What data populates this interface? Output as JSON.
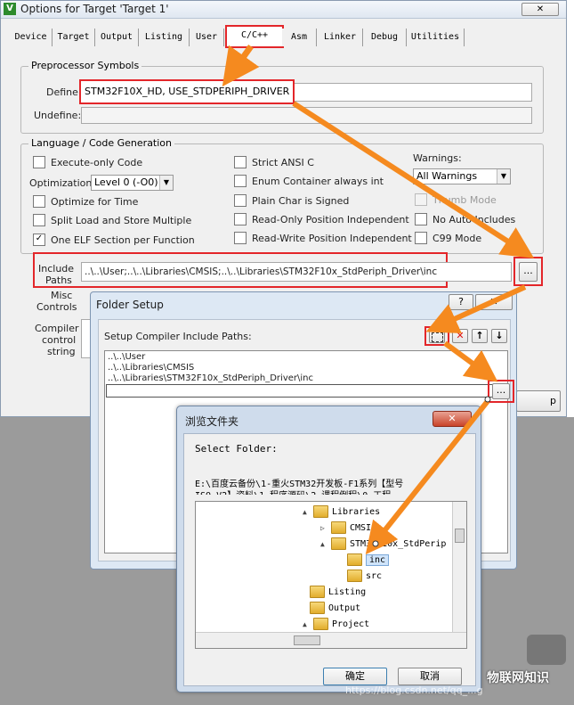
{
  "options_window": {
    "title": "Options for Target 'Target 1'",
    "tabs": [
      "Device",
      "Target",
      "Output",
      "Listing",
      "User",
      "C/C++",
      "Asm",
      "Linker",
      "Debug",
      "Utilities"
    ],
    "active_tab": "C/C++",
    "preprocessor": {
      "group_label": "Preprocessor Symbols",
      "define_label": "Define:",
      "define_value": "STM32F10X_HD, USE_STDPERIPH_DRIVER",
      "undefine_label": "Undefine:"
    },
    "language": {
      "group_label": "Language / Code Generation",
      "execute_only": "Execute-only Code",
      "optimization_label": "Optimization:",
      "optimization_value": "Level 0 (-O0)",
      "optimize_time": "Optimize for Time",
      "split_load": "Split Load and Store Multiple",
      "one_elf": "One ELF Section per Function",
      "strict_ansi": "Strict ANSI C",
      "enum_container": "Enum Container always int",
      "plain_char": "Plain Char is Signed",
      "ro_pi": "Read-Only Position Independent",
      "rw_pi": "Read-Write Position Independent",
      "warnings_label": "Warnings:",
      "warnings_value": "All Warnings",
      "thumb_mode": "Thumb Mode",
      "no_auto": "No Auto Includes",
      "c99": "C99 Mode"
    },
    "include": {
      "label_1": "Include",
      "label_2": "Paths",
      "value": "..\\..\\User;..\\..\\Libraries\\CMSIS;..\\..\\Libraries\\STM32F10x_StdPeriph_Driver\\inc",
      "browse": "..."
    },
    "misc_label_1": "Misc",
    "misc_label_2": "Controls",
    "compiler_label_1": "Compiler",
    "compiler_label_2": "control",
    "compiler_label_3": "string",
    "partial_button": "p"
  },
  "folder_setup": {
    "title": "Folder Setup",
    "help_icon": "?",
    "section_label": "Setup Compiler Include Paths:",
    "paths": [
      "..\\..\\User",
      "..\\..\\Libraries\\CMSIS",
      "..\\..\\Libraries\\STM32F10x_StdPeriph_Driver\\inc"
    ],
    "browse": "..."
  },
  "browse_dialog": {
    "title": "浏览文件夹",
    "prompt": "Select Folder:",
    "path_line_1": "E:\\百度云备份\\1-重火STM32开发板-F1系列【型号",
    "path_line_2": "ISO-V2】资料\\1-程序源码\\2-课程例程\\0-工程",
    "tree": [
      {
        "label": "Libraries",
        "indent": 0,
        "toggle": "▲"
      },
      {
        "label": "CMSIS",
        "indent": 1,
        "toggle": "▷"
      },
      {
        "label": "STM32F10x_StdPerip",
        "indent": 1,
        "toggle": "▲"
      },
      {
        "label": "inc",
        "indent": 2,
        "toggle": ""
      },
      {
        "label": "src",
        "indent": 2,
        "toggle": ""
      },
      {
        "label": "Listing",
        "indent": 0,
        "toggle": ""
      },
      {
        "label": "Output",
        "indent": 0,
        "toggle": ""
      },
      {
        "label": "Project",
        "indent": 0,
        "toggle": "▲"
      }
    ],
    "selected": "inc",
    "ok": "确定",
    "cancel": "取消"
  },
  "watermark": {
    "brand": "物联网知识",
    "url": "https://blog.csdn.net/qq_...g"
  },
  "colors": {
    "highlight": "#e3262a",
    "arrow": "#f58a1f"
  }
}
